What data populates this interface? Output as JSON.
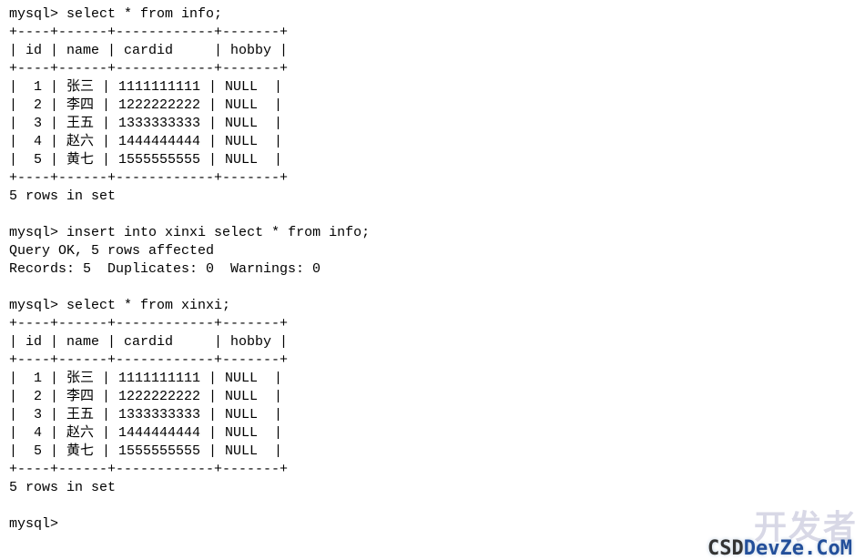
{
  "prompt": "mysql>",
  "queries": {
    "q1": "select * from info;",
    "q2": "insert into xinxi select * from info;",
    "q3": "select * from xinxi;"
  },
  "separator": "+----+------+------------+-------+",
  "header": "| id | name | cardid     | hobby |",
  "table1_rows": [
    {
      "id": 1,
      "name": "张三",
      "cardid": "1111111111",
      "hobby": "NULL"
    },
    {
      "id": 2,
      "name": "李四",
      "cardid": "1222222222",
      "hobby": "NULL"
    },
    {
      "id": 3,
      "name": "王五",
      "cardid": "1333333333",
      "hobby": "NULL"
    },
    {
      "id": 4,
      "name": "赵六",
      "cardid": "1444444444",
      "hobby": "NULL"
    },
    {
      "id": 5,
      "name": "黄七",
      "cardid": "1555555555",
      "hobby": "NULL"
    }
  ],
  "table2_rows": [
    {
      "id": 1,
      "name": "张三",
      "cardid": "1111111111",
      "hobby": "NULL"
    },
    {
      "id": 2,
      "name": "李四",
      "cardid": "1222222222",
      "hobby": "NULL"
    },
    {
      "id": 3,
      "name": "王五",
      "cardid": "1333333333",
      "hobby": "NULL"
    },
    {
      "id": 4,
      "name": "赵六",
      "cardid": "1444444444",
      "hobby": "NULL"
    },
    {
      "id": 5,
      "name": "黄七",
      "cardid": "1555555555",
      "hobby": "NULL"
    }
  ],
  "footer_rows": "5 rows in set",
  "insert_result_line1": "Query OK, 5 rows affected",
  "insert_result_line2": "Records: 5  Duplicates: 0  Warnings: 0",
  "watermark_cn": "开发者",
  "watermark_en_left": "CSD",
  "watermark_en_right": "DevZe.CoM",
  "chart_data": {
    "type": "table",
    "title": "info / xinxi",
    "columns": [
      "id",
      "name",
      "cardid",
      "hobby"
    ],
    "rows": [
      [
        1,
        "张三",
        "1111111111",
        "NULL"
      ],
      [
        2,
        "李四",
        "1222222222",
        "NULL"
      ],
      [
        3,
        "王五",
        "1333333333",
        "NULL"
      ],
      [
        4,
        "赵六",
        "1444444444",
        "NULL"
      ],
      [
        5,
        "黄七",
        "1555555555",
        "NULL"
      ]
    ]
  }
}
